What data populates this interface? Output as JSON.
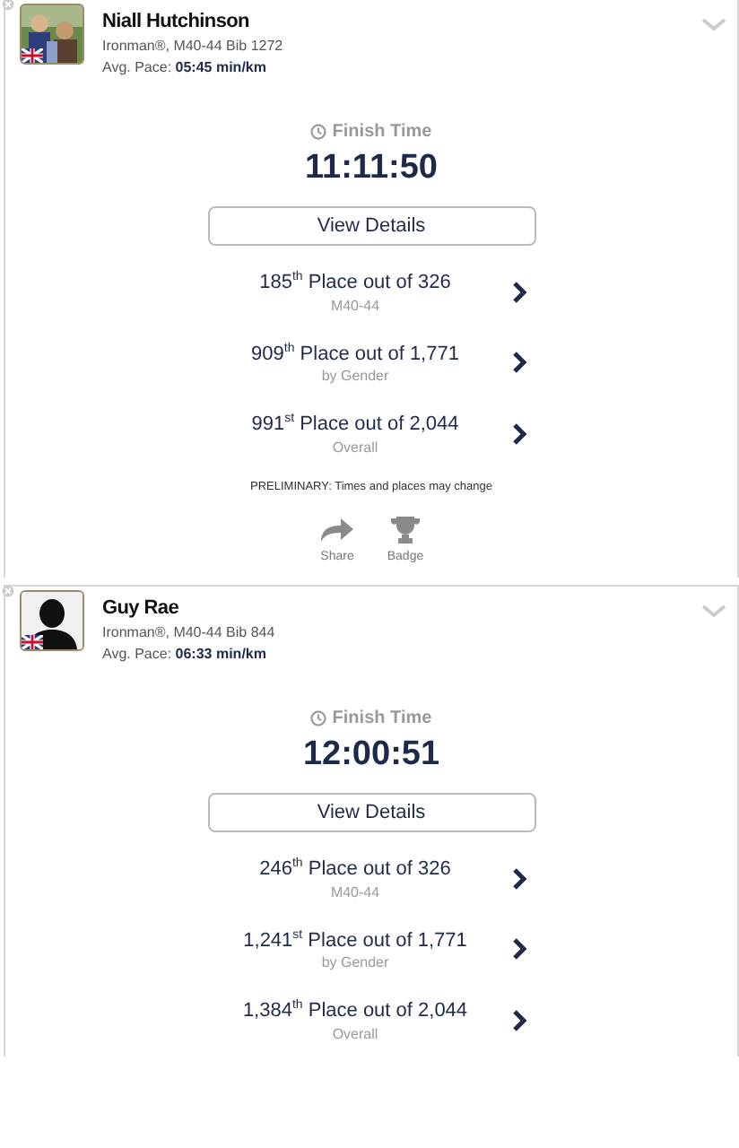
{
  "athletes": [
    {
      "name": "Niall Hutchinson",
      "avatar": {
        "kind": "picture"
      },
      "division": "Ironman®, M40-44 Bib 1272",
      "pace_label": "Avg. Pace:",
      "pace_value": "05:45 min/km",
      "finish_label": "Finish Time",
      "finish_time": "11:11:50",
      "details_button": "View Details",
      "ranks": [
        {
          "place": "185$^{th}$ Place out of 326",
          "category": "M40-44"
        },
        {
          "place": "909$^{th}$ Place out of 1,771",
          "category": "by Gender"
        },
        {
          "place": "991$^{st}$ Place out of 2,044",
          "category": "Overall"
        }
      ],
      "note": "PRELIMINARY: Times and places may change",
      "actions": [
        {
          "kind": "share",
          "label": "Share"
        },
        {
          "kind": "badge",
          "label": "Badge"
        }
      ]
    },
    {
      "name": "Guy Rae",
      "avatar": {
        "kind": "silhouette"
      },
      "division": "Ironman®, M40-44 Bib 844",
      "pace_label": "Avg. Pace:",
      "pace_value": "06:33 min/km",
      "finish_label": "Finish Time",
      "finish_time": "12:00:51",
      "details_button": "View Details",
      "ranks": [
        {
          "place": "246$^{th}$ Place out of 326",
          "category": "M40-44"
        },
        {
          "place": "1,241$^{st}$ Place out of 1,771",
          "category": "by Gender"
        },
        {
          "place": "1,384$^{th}$ Place out of 2,044",
          "category": "Overall"
        }
      ]
    }
  ]
}
